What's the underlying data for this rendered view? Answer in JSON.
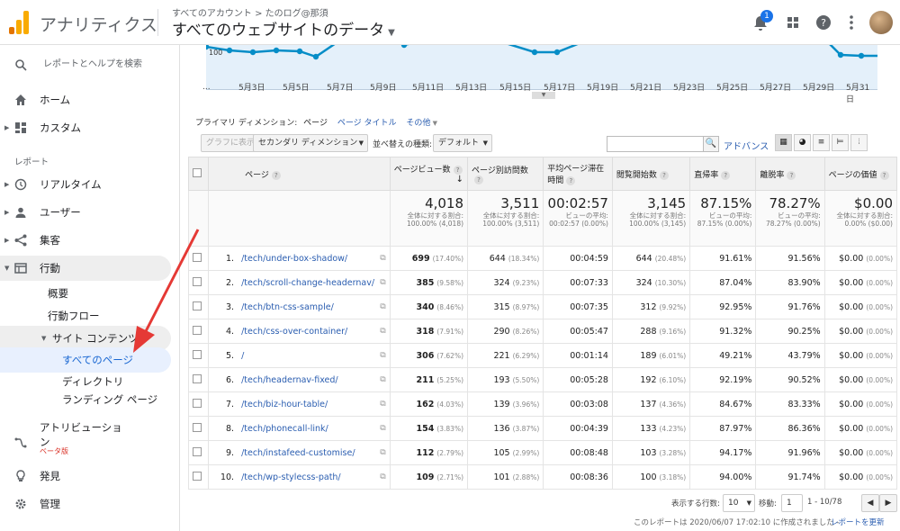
{
  "header": {
    "app_title": "アナリティクス",
    "account_path": "すべてのアカウント > たのログ@那須",
    "view_title": "すべてのウェブサイトのデータ",
    "notification_count": "1"
  },
  "sidebar": {
    "search_placeholder": "レポートとヘルプを検索",
    "home": "ホーム",
    "custom": "カスタム",
    "section_reports": "レポート",
    "realtime": "リアルタイム",
    "users": "ユーザー",
    "acquisition": "集客",
    "behavior": "行動",
    "overview": "概要",
    "behavior_flow": "行動フロー",
    "site_content": "サイト コンテンツ",
    "all_pages": "すべてのページ",
    "directory": "ディレクトリ",
    "landing_pages": "ランディング ページ",
    "attribution": "アトリビューション",
    "beta": "ベータ版",
    "discover": "発見",
    "admin": "管理"
  },
  "chart_axis": {
    "y_label": "100",
    "x_labels": [
      "...",
      "5月3日",
      "5月5日",
      "5月7日",
      "5月9日",
      "5月11日",
      "5月13日",
      "5月15日",
      "5月17日",
      "5月19日",
      "5月21日",
      "5月23日",
      "5月25日",
      "5月27日",
      "5月29日",
      "5月31日"
    ]
  },
  "dimension": {
    "label": "プライマリ ディメンション:",
    "active": "ページ",
    "page_title": "ページ タイトル",
    "other": "その他"
  },
  "toolbar": {
    "graph_btn": "グラフに表示",
    "secondary_dim": "セカンダリ ディメンション",
    "sort_label": "並べ替えの種類:",
    "sort_value": "デフォルト",
    "advanced": "アドバンス"
  },
  "columns": {
    "page": "ページ",
    "pageviews": "ページビュー数",
    "unique_pageviews": "ページ別訪問数",
    "avg_time": "平均ページ滞在時間",
    "entrances": "閲覧開始数",
    "bounce_rate": "直帰率",
    "exit_rate": "離脱率",
    "page_value": "ページの価値"
  },
  "totals": {
    "pageviews": "4,018",
    "pageviews_sub": "全体に対する割合: 100.00% (4,018)",
    "unique": "3,511",
    "unique_sub": "全体に対する割合: 100.00% (3,511)",
    "avg_time": "00:02:57",
    "avg_time_sub": "ビューの平均: 00:02:57 (0.00%)",
    "entrances": "3,145",
    "entrances_sub": "全体に対する割合: 100.00% (3,145)",
    "bounce": "87.15%",
    "bounce_sub": "ビューの平均: 87.15% (0.00%)",
    "exit": "78.27%",
    "exit_sub": "ビューの平均: 78.27% (0.00%)",
    "value": "$0.00",
    "value_sub": "全体に対する割合: 0.00% ($0.00)"
  },
  "rows": [
    {
      "n": "1.",
      "page": "/tech/under-box-shadow/",
      "pv": "699",
      "pvp": "(17.40%)",
      "u": "644",
      "up": "(18.34%)",
      "t": "00:04:59",
      "e": "644",
      "ep": "(20.48%)",
      "b": "91.61%",
      "x": "91.56%",
      "v": "$0.00",
      "vp": "(0.00%)"
    },
    {
      "n": "2.",
      "page": "/tech/scroll-change-headernav/",
      "pv": "385",
      "pvp": "(9.58%)",
      "u": "324",
      "up": "(9.23%)",
      "t": "00:07:33",
      "e": "324",
      "ep": "(10.30%)",
      "b": "87.04%",
      "x": "83.90%",
      "v": "$0.00",
      "vp": "(0.00%)"
    },
    {
      "n": "3.",
      "page": "/tech/btn-css-sample/",
      "pv": "340",
      "pvp": "(8.46%)",
      "u": "315",
      "up": "(8.97%)",
      "t": "00:07:35",
      "e": "312",
      "ep": "(9.92%)",
      "b": "92.95%",
      "x": "91.76%",
      "v": "$0.00",
      "vp": "(0.00%)"
    },
    {
      "n": "4.",
      "page": "/tech/css-over-container/",
      "pv": "318",
      "pvp": "(7.91%)",
      "u": "290",
      "up": "(8.26%)",
      "t": "00:05:47",
      "e": "288",
      "ep": "(9.16%)",
      "b": "91.32%",
      "x": "90.25%",
      "v": "$0.00",
      "vp": "(0.00%)"
    },
    {
      "n": "5.",
      "page": "/",
      "pv": "306",
      "pvp": "(7.62%)",
      "u": "221",
      "up": "(6.29%)",
      "t": "00:01:14",
      "e": "189",
      "ep": "(6.01%)",
      "b": "49.21%",
      "x": "43.79%",
      "v": "$0.00",
      "vp": "(0.00%)"
    },
    {
      "n": "6.",
      "page": "/tech/headernav-fixed/",
      "pv": "211",
      "pvp": "(5.25%)",
      "u": "193",
      "up": "(5.50%)",
      "t": "00:05:28",
      "e": "192",
      "ep": "(6.10%)",
      "b": "92.19%",
      "x": "90.52%",
      "v": "$0.00",
      "vp": "(0.00%)"
    },
    {
      "n": "7.",
      "page": "/tech/biz-hour-table/",
      "pv": "162",
      "pvp": "(4.03%)",
      "u": "139",
      "up": "(3.96%)",
      "t": "00:03:08",
      "e": "137",
      "ep": "(4.36%)",
      "b": "84.67%",
      "x": "83.33%",
      "v": "$0.00",
      "vp": "(0.00%)"
    },
    {
      "n": "8.",
      "page": "/tech/phonecall-link/",
      "pv": "154",
      "pvp": "(3.83%)",
      "u": "136",
      "up": "(3.87%)",
      "t": "00:04:39",
      "e": "133",
      "ep": "(4.23%)",
      "b": "87.97%",
      "x": "86.36%",
      "v": "$0.00",
      "vp": "(0.00%)"
    },
    {
      "n": "9.",
      "page": "/tech/instafeed-customise/",
      "pv": "112",
      "pvp": "(2.79%)",
      "u": "105",
      "up": "(2.99%)",
      "t": "00:08:48",
      "e": "103",
      "ep": "(3.28%)",
      "b": "94.17%",
      "x": "91.96%",
      "v": "$0.00",
      "vp": "(0.00%)"
    },
    {
      "n": "10.",
      "page": "/tech/wp-stylecss-path/",
      "pv": "109",
      "pvp": "(2.71%)",
      "u": "101",
      "up": "(2.88%)",
      "t": "00:08:36",
      "e": "100",
      "ep": "(3.18%)",
      "b": "94.00%",
      "x": "91.74%",
      "v": "$0.00",
      "vp": "(0.00%)"
    }
  ],
  "pagination": {
    "rows_label": "表示する行数:",
    "rows_value": "10",
    "goto_label": "移動:",
    "goto_value": "1",
    "range": "1 - 10/78"
  },
  "footer": {
    "created": "このレポートは 2020/06/07 17:02:10 に作成されました -",
    "refresh": "レポートを更新"
  }
}
